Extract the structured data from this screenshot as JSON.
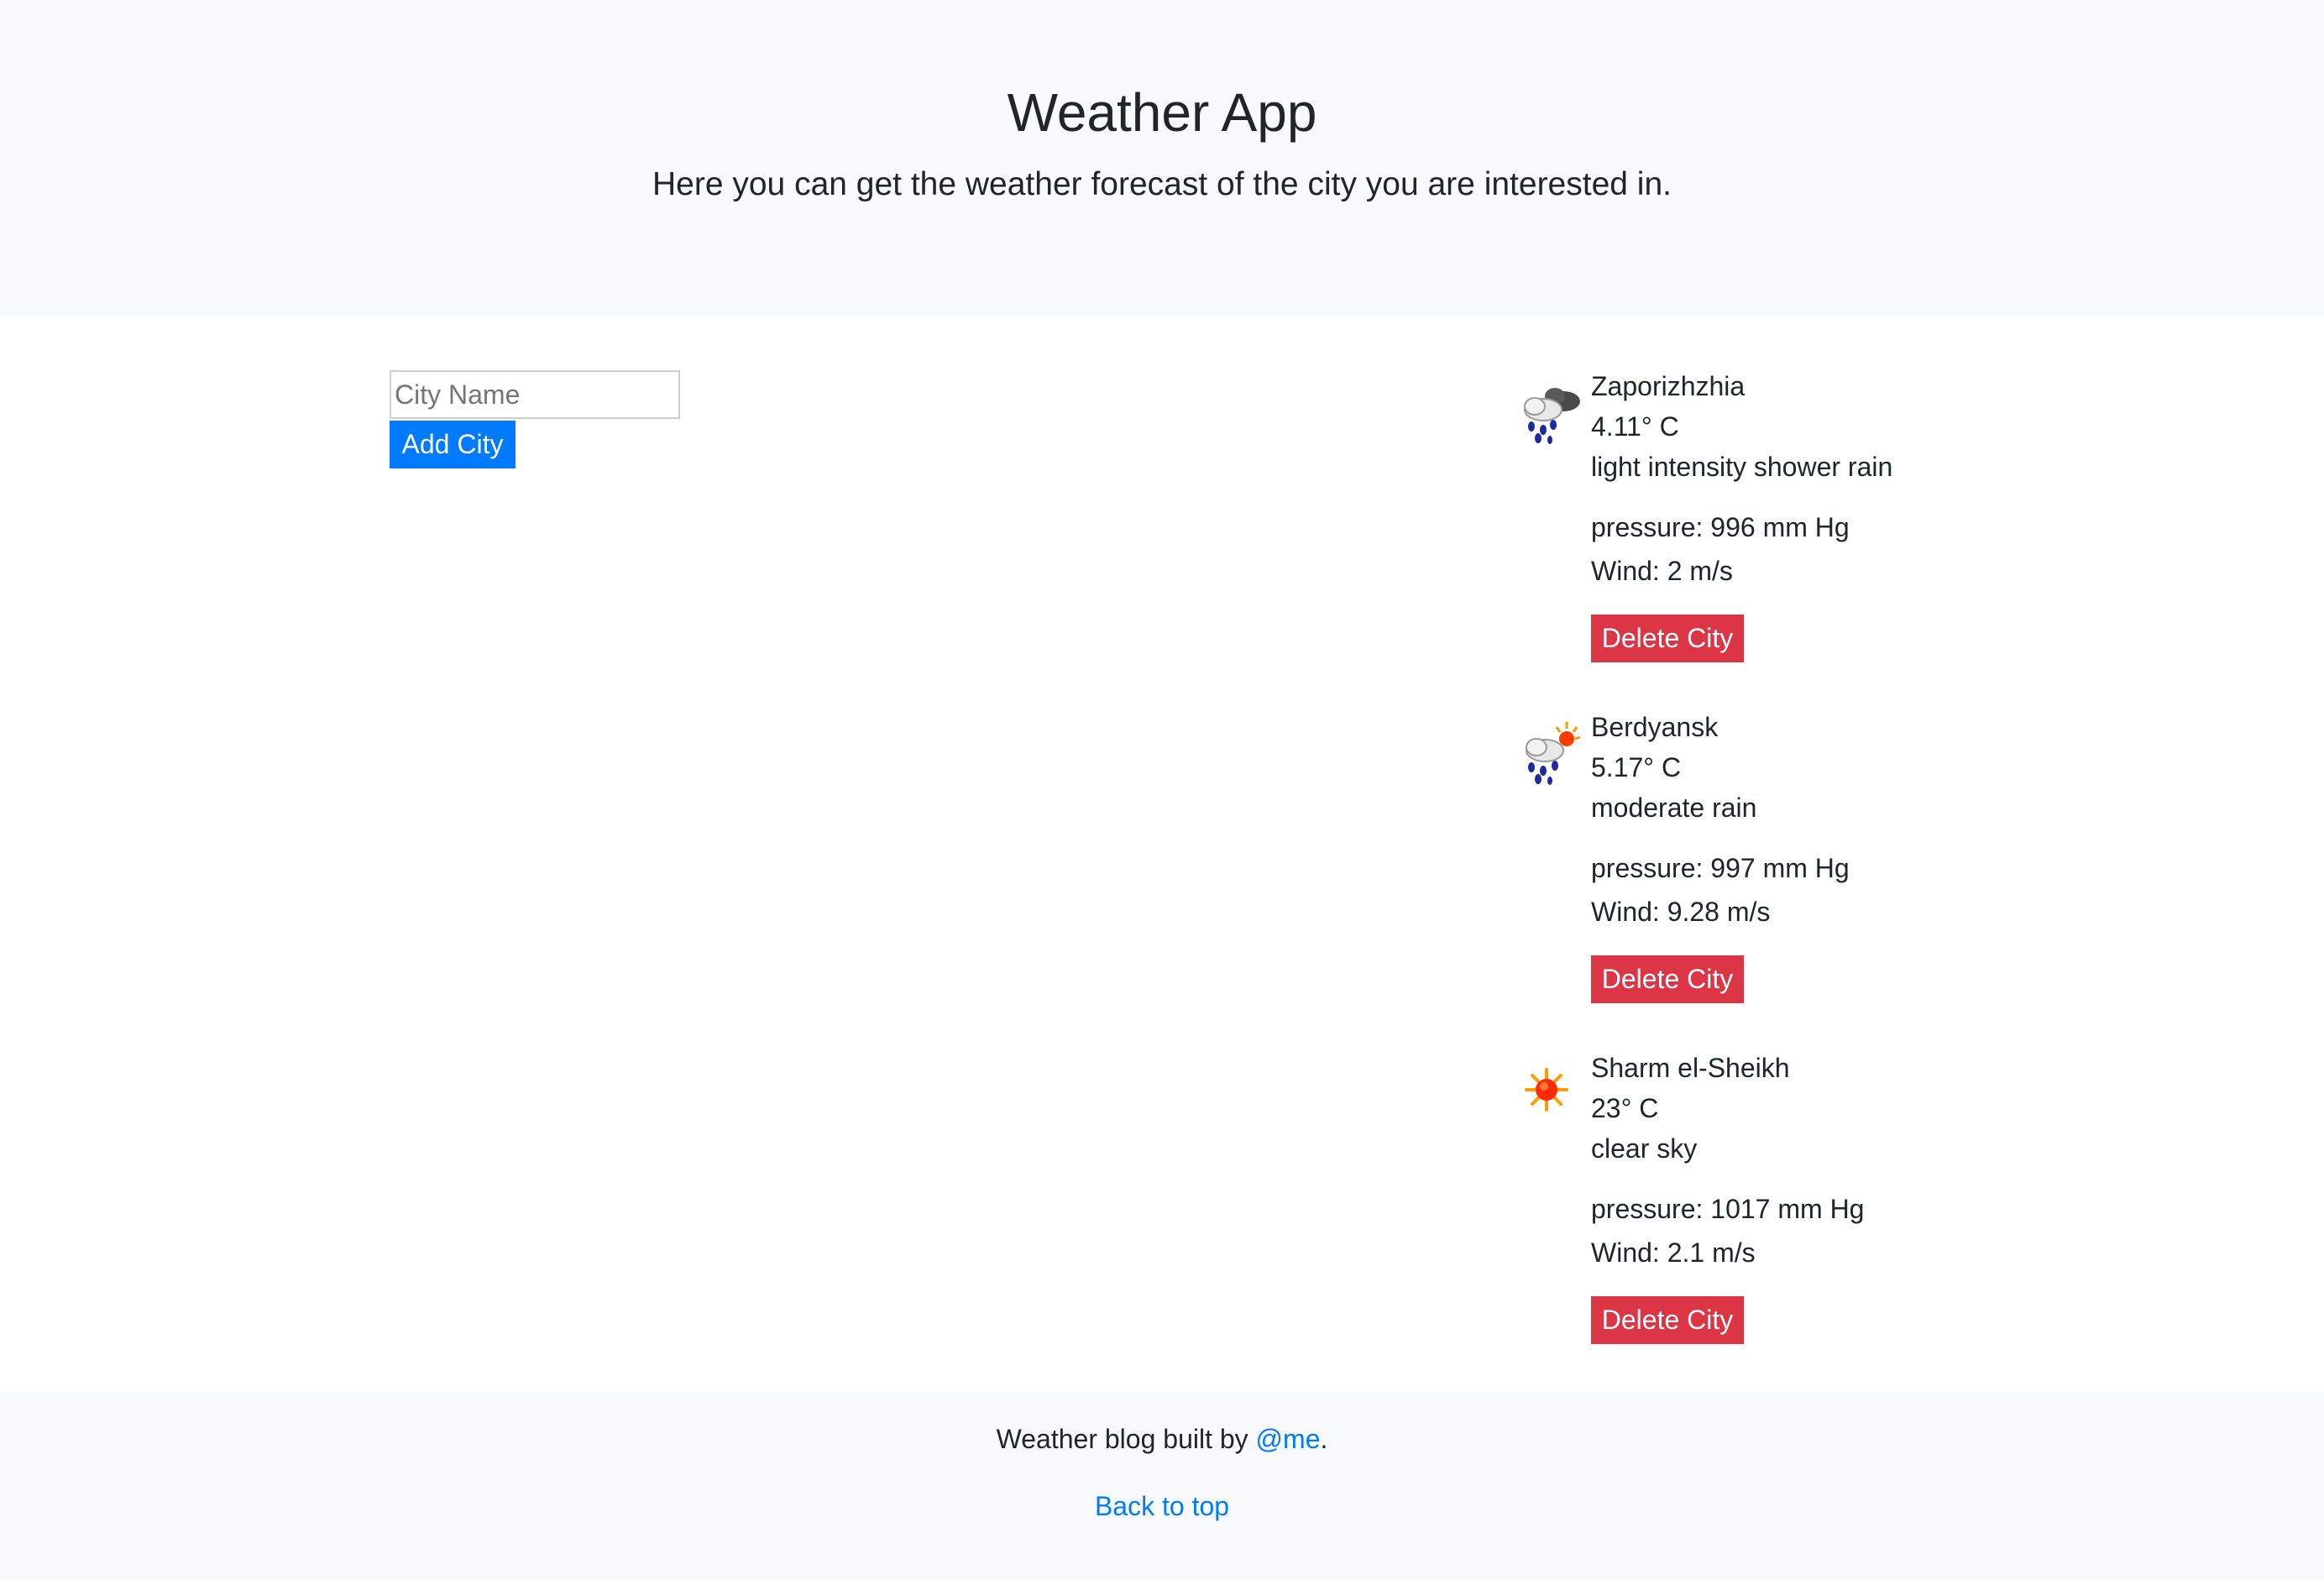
{
  "header": {
    "title": "Weather App",
    "subtitle": "Here you can get the weather forecast of the city you are interested in."
  },
  "form": {
    "city_placeholder": "City Name",
    "city_value": "",
    "add_label": "Add City"
  },
  "cities": [
    {
      "name": "Zaporizhzhia",
      "temp": "4.11° C",
      "description": "light intensity shower rain",
      "pressure": "pressure: 996 mm Hg",
      "wind": "Wind: 2 m/s",
      "icon": "shower-rain-icon",
      "delete_label": "Delete City"
    },
    {
      "name": "Berdyansk",
      "temp": "5.17° C",
      "description": "moderate rain",
      "pressure": "pressure: 997 mm Hg",
      "wind": "Wind: 9.28 m/s",
      "icon": "rain-sun-icon",
      "delete_label": "Delete City"
    },
    {
      "name": "Sharm el-Sheikh",
      "temp": "23° C",
      "description": "clear sky",
      "pressure": "pressure: 1017 mm Hg",
      "wind": "Wind: 2.1 m/s",
      "icon": "sun-icon",
      "delete_label": "Delete City"
    }
  ],
  "footer": {
    "built_by_prefix": "Weather blog built by ",
    "built_by_link": "@me",
    "built_by_suffix": ".",
    "back_to_top": "Back to top"
  },
  "colors": {
    "primary": "#007bff",
    "danger": "#dc3545",
    "light_bg": "#f8f9fa",
    "text": "#212529"
  }
}
